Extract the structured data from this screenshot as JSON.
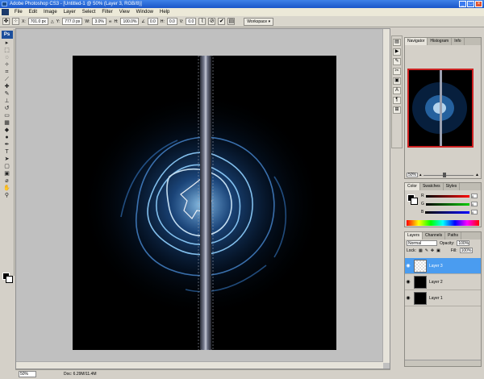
{
  "window": {
    "title": "Adobe Photoshop CS3 - [Untitled-1 @ 50% (Layer 3, RGB/8)]"
  },
  "menu": [
    "File",
    "Edit",
    "Image",
    "Layer",
    "Select",
    "Filter",
    "View",
    "Window",
    "Help"
  ],
  "options": {
    "x_label": "X:",
    "x_value": "701.0 px",
    "y_label": "Y:",
    "y_value": "777.0 px",
    "w_label": "W:",
    "w_value": "3.0%",
    "h_label": "H:",
    "h_value": "100.0%",
    "rot_value": "0.0",
    "hskew_label": "H:",
    "hskew_value": "0.0",
    "vskew_label": "V:",
    "vskew_value": "0.0",
    "workspace_label": "Workspace ▾"
  },
  "tools": {
    "logo": "Ps"
  },
  "status": {
    "zoom": "50%",
    "doc_size": "Doc: 6.29M/11.4M"
  },
  "navigator": {
    "tabs": [
      "Navigator",
      "Histogram",
      "Info"
    ],
    "zoom": "50%"
  },
  "color_panel": {
    "tabs": [
      "Color",
      "Swatches",
      "Styles"
    ],
    "r_label": "R",
    "r_value": "0",
    "g_label": "G",
    "g_value": "0",
    "b_label": "B",
    "b_value": "0"
  },
  "layers_panel": {
    "tabs": [
      "Layers",
      "Channels",
      "Paths"
    ],
    "blend_mode": "Normal",
    "opacity_label": "Opacity:",
    "opacity_value": "100%",
    "lock_label": "Lock:",
    "fill_label": "Fill:",
    "fill_value": "100%",
    "layers": [
      {
        "name": "Layer 3",
        "active": true
      },
      {
        "name": "Layer 2",
        "active": false
      },
      {
        "name": "Layer 1",
        "active": false
      }
    ]
  },
  "colors": {
    "selection_blue": "#4a9cf0",
    "accent_red": "#cc2222"
  }
}
